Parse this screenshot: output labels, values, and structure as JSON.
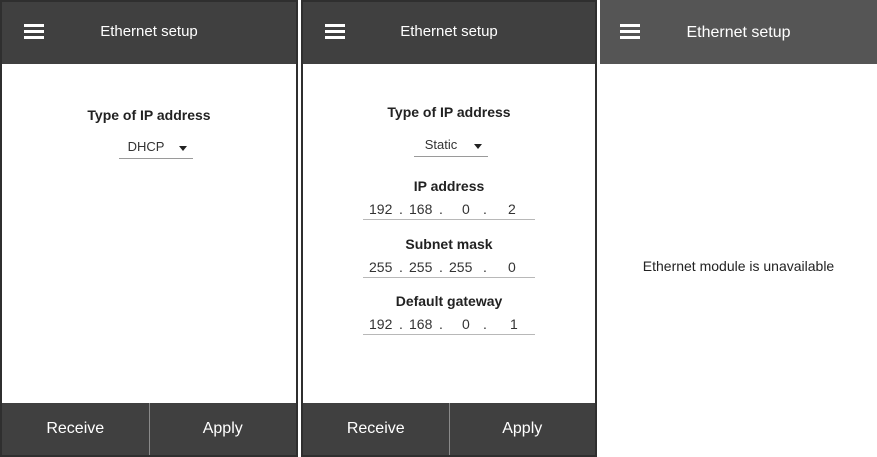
{
  "screens": [
    {
      "title": "Ethernet setup",
      "ip_type_label": "Type of IP address",
      "ip_type_value": "DHCP",
      "receive_label": "Receive",
      "apply_label": "Apply"
    },
    {
      "title": "Ethernet setup",
      "ip_type_label": "Type of IP address",
      "ip_type_value": "Static",
      "ip_address": {
        "label": "IP address",
        "octets": [
          "192",
          "168",
          "0",
          "2"
        ]
      },
      "subnet_mask": {
        "label": "Subnet mask",
        "octets": [
          "255",
          "255",
          "255",
          "0"
        ]
      },
      "default_gateway": {
        "label": "Default gateway",
        "octets": [
          "192",
          "168",
          "0",
          "1"
        ]
      },
      "receive_label": "Receive",
      "apply_label": "Apply"
    },
    {
      "title": "Ethernet setup",
      "message": "Ethernet module is unavailable"
    }
  ],
  "icons": {
    "menu": "hamburger-menu-icon",
    "dropdown": "caret-down-icon"
  },
  "colors": {
    "appbar": "#404040",
    "appbar_disabled": "#555555",
    "text_on_bar": "#ffffff"
  }
}
